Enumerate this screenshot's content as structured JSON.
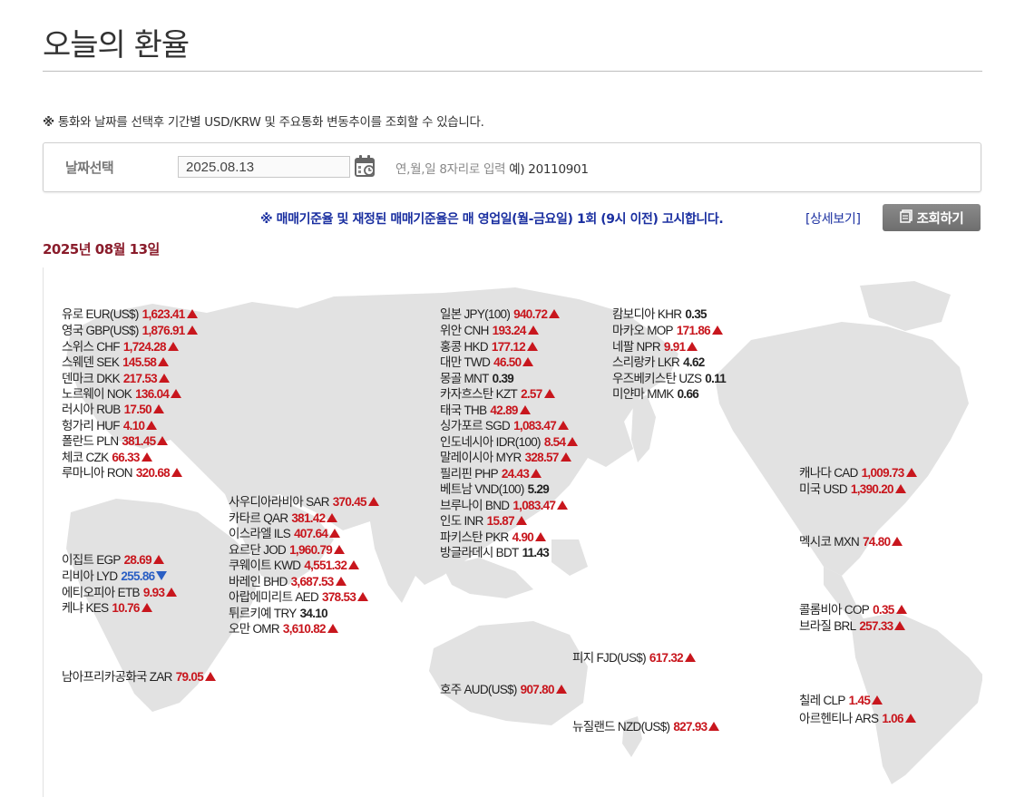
{
  "page": {
    "title": "오늘의 환율",
    "notice_mark": "※",
    "notice": "통화와 날짜를 선택후 기간별 USD/KRW 및 주요통화 변동추이를 조회할 수 있습니다.",
    "date_label": "날짜선택",
    "date_value": "2025.08.13",
    "date_help": "연,월,일 8자리로 입력",
    "date_example": "예) 20110901",
    "notice2": "※ 매매기준율 및 재정된 매매기준율은 매 영업일(월-금요일) 1회 (9시 이전) 고시합니다.",
    "detail_link": "[상세보기]",
    "inquiry_button": "조회하기",
    "date_heading": "2025년 08월 13일"
  },
  "icons": {
    "calendar": "calendar-icon",
    "document": "document-icon"
  },
  "colors": {
    "up": "#c8161d",
    "down": "#2a5fc4",
    "date_heading": "#8a1c2b",
    "notice": "#1a2fa0"
  },
  "rates": [
    {
      "name": "유로 EUR(US$)",
      "value": "1,623.41",
      "dir": "up"
    },
    {
      "name": "영국 GBP(US$)",
      "value": "1,876.91",
      "dir": "up"
    },
    {
      "name": "스위스 CHF",
      "value": "1,724.28",
      "dir": "up"
    },
    {
      "name": "스웨덴 SEK",
      "value": "145.58",
      "dir": "up"
    },
    {
      "name": "덴마크 DKK",
      "value": "217.53",
      "dir": "up"
    },
    {
      "name": "노르웨이 NOK",
      "value": "136.04",
      "dir": "up"
    },
    {
      "name": "러시아 RUB",
      "value": "17.50",
      "dir": "up"
    },
    {
      "name": "헝가리 HUF",
      "value": "4.10",
      "dir": "up"
    },
    {
      "name": "폴란드 PLN",
      "value": "381.45",
      "dir": "up"
    },
    {
      "name": "체코 CZK",
      "value": "66.33",
      "dir": "up"
    },
    {
      "name": "루마니아 RON",
      "value": "320.68",
      "dir": "up"
    },
    {
      "name": "이집트 EGP",
      "value": "28.69",
      "dir": "up"
    },
    {
      "name": "리비아 LYD",
      "value": "255.86",
      "dir": "down"
    },
    {
      "name": "에티오피아 ETB",
      "value": "9.93",
      "dir": "up"
    },
    {
      "name": "케냐 KES",
      "value": "10.76",
      "dir": "up"
    },
    {
      "name": "남아프리카공화국 ZAR",
      "value": "79.05",
      "dir": "up"
    },
    {
      "name": "사우디아라비아 SAR",
      "value": "370.45",
      "dir": "up"
    },
    {
      "name": "카타르 QAR",
      "value": "381.42",
      "dir": "up"
    },
    {
      "name": "이스라엘 ILS",
      "value": "407.64",
      "dir": "up"
    },
    {
      "name": "요르단 JOD",
      "value": "1,960.79",
      "dir": "up"
    },
    {
      "name": "쿠웨이트 KWD",
      "value": "4,551.32",
      "dir": "up"
    },
    {
      "name": "바레인 BHD",
      "value": "3,687.53",
      "dir": "up"
    },
    {
      "name": "아랍에미리트 AED",
      "value": "378.53",
      "dir": "up"
    },
    {
      "name": "튀르키예 TRY",
      "value": "34.10",
      "dir": "flat"
    },
    {
      "name": "오만 OMR",
      "value": "3,610.82",
      "dir": "up"
    },
    {
      "name": "일본 JPY(100)",
      "value": "940.72",
      "dir": "up"
    },
    {
      "name": "위안 CNH",
      "value": "193.24",
      "dir": "up"
    },
    {
      "name": "홍콩 HKD",
      "value": "177.12",
      "dir": "up"
    },
    {
      "name": "대만 TWD",
      "value": "46.50",
      "dir": "up"
    },
    {
      "name": "몽골 MNT",
      "value": "0.39",
      "dir": "flat"
    },
    {
      "name": "카자흐스탄 KZT",
      "value": "2.57",
      "dir": "up"
    },
    {
      "name": "태국 THB",
      "value": "42.89",
      "dir": "up"
    },
    {
      "name": "싱가포르 SGD",
      "value": "1,083.47",
      "dir": "up"
    },
    {
      "name": "인도네시아 IDR(100)",
      "value": "8.54",
      "dir": "up"
    },
    {
      "name": "말레이시아 MYR",
      "value": "328.57",
      "dir": "up"
    },
    {
      "name": "필리핀 PHP",
      "value": "24.43",
      "dir": "up"
    },
    {
      "name": "베트남 VND(100)",
      "value": "5.29",
      "dir": "flat"
    },
    {
      "name": "브루나이 BND",
      "value": "1,083.47",
      "dir": "up"
    },
    {
      "name": "인도 INR",
      "value": "15.87",
      "dir": "up"
    },
    {
      "name": "파키스탄 PKR",
      "value": "4.90",
      "dir": "up"
    },
    {
      "name": "방글라데시 BDT",
      "value": "11.43",
      "dir": "flat"
    },
    {
      "name": "캄보디아 KHR",
      "value": "0.35",
      "dir": "flat"
    },
    {
      "name": "마카오 MOP",
      "value": "171.86",
      "dir": "up"
    },
    {
      "name": "네팔 NPR",
      "value": "9.91",
      "dir": "up"
    },
    {
      "name": "스리랑카 LKR",
      "value": "4.62",
      "dir": "flat"
    },
    {
      "name": "우즈베키스탄 UZS",
      "value": "0.11",
      "dir": "flat"
    },
    {
      "name": "미얀마 MMK",
      "value": "0.66",
      "dir": "flat"
    },
    {
      "name": "호주 AUD(US$)",
      "value": "907.80",
      "dir": "up"
    },
    {
      "name": "피지 FJD(US$)",
      "value": "617.32",
      "dir": "up"
    },
    {
      "name": "뉴질랜드 NZD(US$)",
      "value": "827.93",
      "dir": "up"
    },
    {
      "name": "캐나다 CAD",
      "value": "1,009.73",
      "dir": "up"
    },
    {
      "name": "미국 USD",
      "value": "1,390.20",
      "dir": "up"
    },
    {
      "name": "멕시코 MXN",
      "value": "74.80",
      "dir": "up"
    },
    {
      "name": "콜롬비아 COP",
      "value": "0.35",
      "dir": "up"
    },
    {
      "name": "브라질 BRL",
      "value": "257.33",
      "dir": "up"
    },
    {
      "name": "칠레 CLP",
      "value": "1.45",
      "dir": "up"
    },
    {
      "name": "아르헨티나 ARS",
      "value": "1.06",
      "dir": "up"
    }
  ]
}
